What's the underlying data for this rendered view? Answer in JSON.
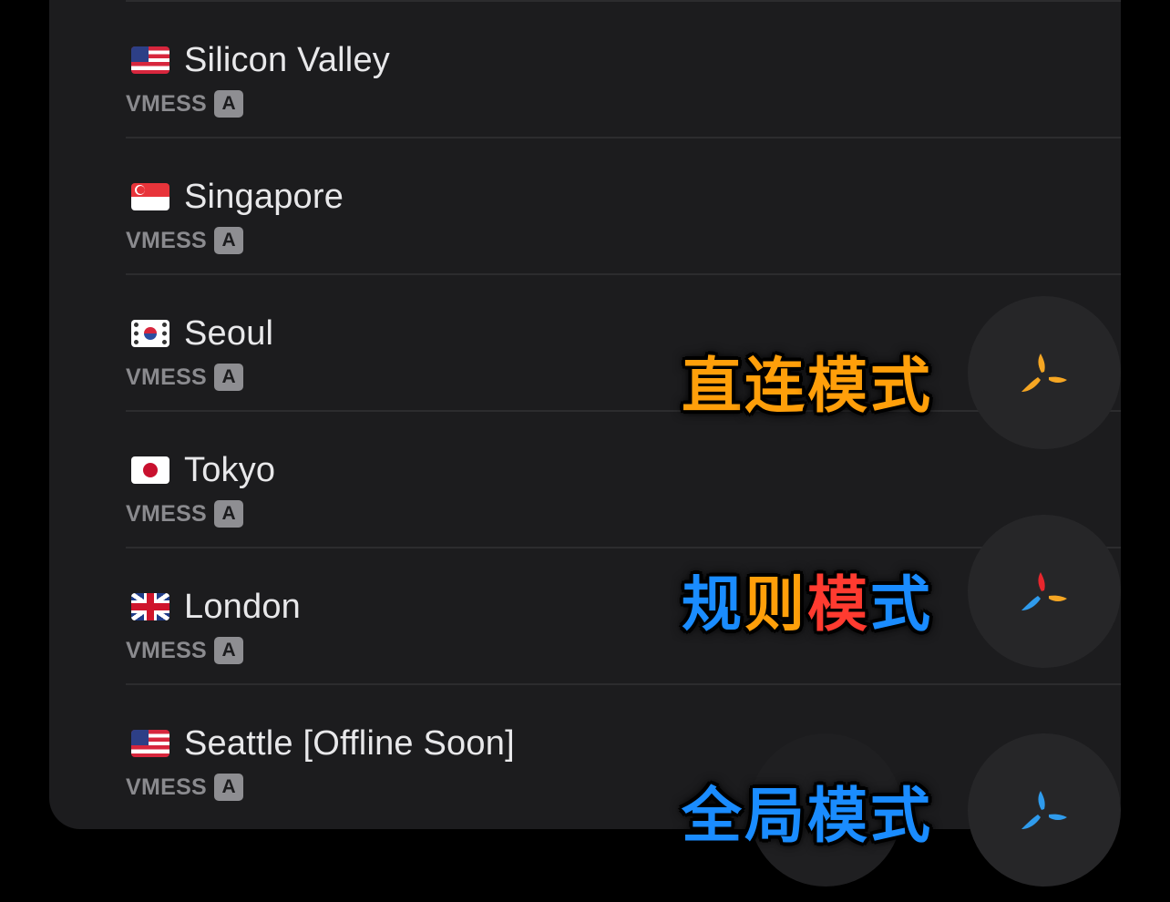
{
  "servers": [
    {
      "flag": "us",
      "name": "Silicon Valley",
      "protocol": "VMESS",
      "badge": "A"
    },
    {
      "flag": "sg",
      "name": "Singapore",
      "protocol": "VMESS",
      "badge": "A"
    },
    {
      "flag": "kr",
      "name": "Seoul",
      "protocol": "VMESS",
      "badge": "A"
    },
    {
      "flag": "jp",
      "name": "Tokyo",
      "protocol": "VMESS",
      "badge": "A"
    },
    {
      "flag": "gb",
      "name": "London",
      "protocol": "VMESS",
      "badge": "A"
    },
    {
      "flag": "us",
      "name": "Seattle [Offline Soon]",
      "protocol": "VMESS",
      "badge": "A"
    }
  ],
  "modes": {
    "direct": {
      "chars": [
        "直",
        "连",
        "模",
        "式"
      ],
      "char_colors": [
        "#ff9f0a",
        "#ff9f0a",
        "#ff9f0a",
        "#ff9f0a"
      ],
      "icon": "trefoil-icon",
      "icon_colors": [
        "#f5a623",
        "#f5a623",
        "#f5a623"
      ]
    },
    "rule": {
      "chars": [
        "规",
        "则",
        "模",
        "式"
      ],
      "char_colors": [
        "#1a8cff",
        "#ff9f0a",
        "#ff3b30",
        "#1a8cff"
      ],
      "icon": "trefoil-icon",
      "icon_colors": [
        "#e8262d",
        "#f5a623",
        "#2f9bec"
      ]
    },
    "global": {
      "chars": [
        "全",
        "局",
        "模",
        "式"
      ],
      "char_colors": [
        "#1a8cff",
        "#1a8cff",
        "#1a8cff",
        "#1a8cff"
      ],
      "icon": "trefoil-icon",
      "icon_colors": [
        "#2f9bec",
        "#2f9bec",
        "#2f9bec"
      ]
    }
  }
}
